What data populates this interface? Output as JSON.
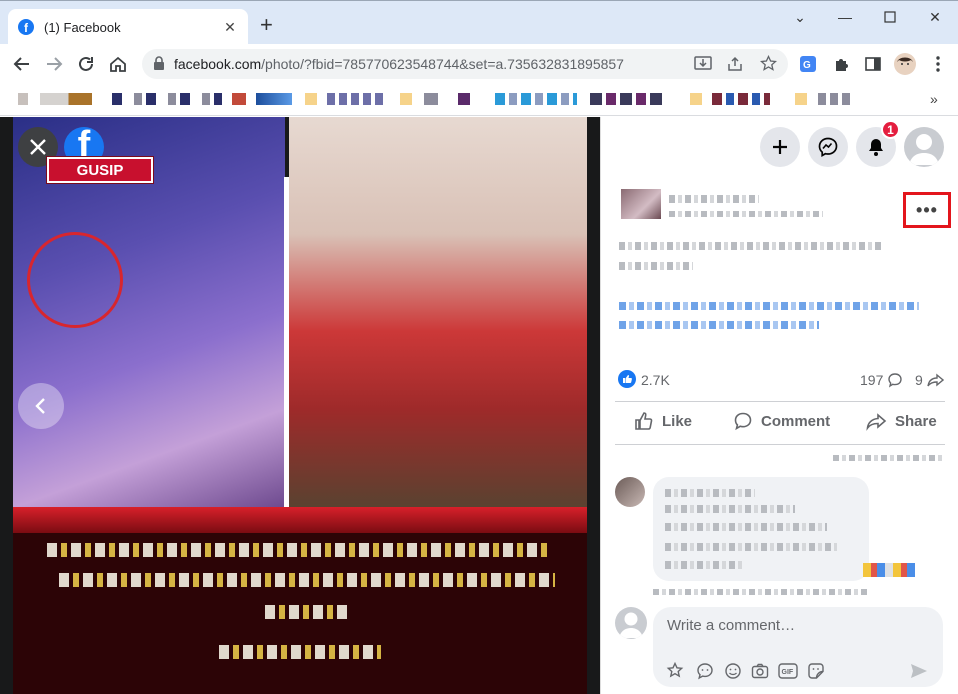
{
  "browser": {
    "tab_title": "(1) Facebook",
    "new_tab_symbol": "+",
    "url_host": "facebook.com",
    "url_path": "/photo/?fbid=785770623548744&set=a.735632831895857",
    "bookmarks_more": "»"
  },
  "viewer": {
    "logo_letter": "f",
    "overlay_tag": "GUSIP"
  },
  "panel": {
    "notification_count": "1",
    "more_label": "•••",
    "reactions_count": "2.7K",
    "comments_count": "197",
    "shares_count": "9",
    "actions": {
      "like": "Like",
      "comment": "Comment",
      "share": "Share"
    },
    "write_placeholder": "Write a comment…"
  },
  "colors": {
    "facebook_blue": "#1877f2",
    "notification_red": "#e41e3f",
    "highlight_box_red": "#e3151c",
    "overlay_tag_red": "#c8102e"
  },
  "icons": [
    "close-icon",
    "facebook-logo-icon",
    "chevron-left-icon",
    "plus-icon",
    "messenger-icon",
    "bell-icon",
    "like-icon",
    "comment-icon",
    "share-icon",
    "sticker-icon",
    "emoji-icon",
    "camera-icon",
    "gif-icon",
    "send-icon"
  ]
}
